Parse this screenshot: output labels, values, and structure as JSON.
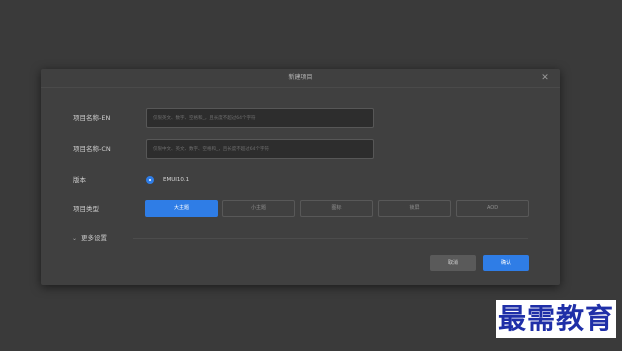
{
  "dialog": {
    "title": "新建项目",
    "close_glyph": "✕",
    "fields": {
      "name_en": {
        "label": "项目名称-EN",
        "value": "",
        "placeholder": "仅限英文、数字、空格和_，且长度不超过64个字符"
      },
      "name_cn": {
        "label": "项目名称-CN",
        "value": "",
        "placeholder": "仅限中文、英文、数字、空格和_，且长度不超过64个字符"
      }
    },
    "version": {
      "label": "版本",
      "option": "EMUI10.1",
      "selected": true
    },
    "project_type": {
      "label": "项目类型",
      "options": [
        "大主题",
        "小主题",
        "图标",
        "锁屏",
        "AOD"
      ],
      "selected": "大主题"
    },
    "more_settings": {
      "chevron": "⌄",
      "label": "更多设置"
    },
    "buttons": {
      "cancel": "取消",
      "confirm": "确认"
    }
  },
  "watermark": "最需教育",
  "colors": {
    "accent": "#2f7de6",
    "backdrop": "#3a3a3a",
    "dialog_bg": "#404040"
  },
  "icons": {
    "close": "close-icon",
    "chevron": "chevron-down-icon",
    "radio": "radio-selected-icon"
  }
}
